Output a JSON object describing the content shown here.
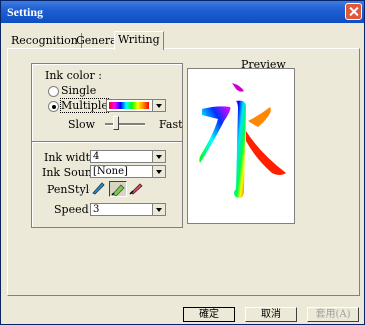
{
  "window": {
    "title": "Setting"
  },
  "tabs": [
    "Recognition",
    "General",
    "Writing"
  ],
  "ink_color": {
    "label": "Ink color :",
    "option_single": "Single",
    "option_multiple": "Multiple",
    "selected": "Multiple"
  },
  "speed_slider": {
    "slow": "Slow",
    "fast": "Fast",
    "value_fraction": 0.25
  },
  "ink_width": {
    "label": "Ink width :",
    "value": "4"
  },
  "ink_sound": {
    "label": "Ink Sound :",
    "value": "[None]"
  },
  "pen_style": {
    "label": "PenStyle :",
    "icons": [
      "pen-brush-icon",
      "pen-marker-icon",
      "pen-nib-icon"
    ]
  },
  "speed": {
    "label": "Speed :",
    "value": "3"
  },
  "preview": {
    "label": "Preview",
    "glyph": "永"
  },
  "buttons": {
    "ok": "確定",
    "cancel": "取消",
    "apply": "套用(A)"
  }
}
